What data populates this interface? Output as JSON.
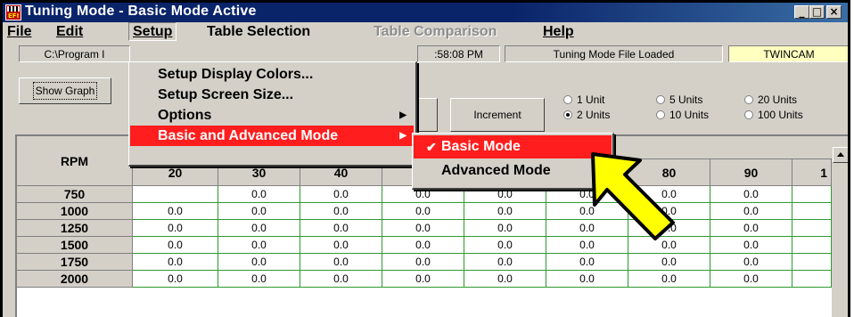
{
  "window": {
    "title": "Tuning Mode - Basic Mode Active",
    "controls": [
      "_",
      "□",
      "×"
    ]
  },
  "menubar": {
    "file": "File",
    "edit": "Edit",
    "setup": "Setup",
    "table_selection": "Table Selection",
    "table_comparison": "Table Comparison",
    "help": "Help"
  },
  "toolbar": {
    "path": "C:\\Program I",
    "time": ":58:08 PM",
    "status": "Tuning Mode File Loaded",
    "engine": "TWINCAM",
    "engine_color": "#ffffc0",
    "show_graph": "Show Graph",
    "increment": "Increment",
    "units": [
      {
        "label": "1 Unit",
        "selected": false
      },
      {
        "label": "2 Units",
        "selected": true
      },
      {
        "label": "5 Units",
        "selected": false
      },
      {
        "label": "10 Units",
        "selected": false
      },
      {
        "label": "20 Units",
        "selected": false
      },
      {
        "label": "100 Units",
        "selected": false
      }
    ]
  },
  "setup_menu": {
    "items": [
      {
        "label": "Setup Display Colors...",
        "submenu": false
      },
      {
        "label": "Setup Screen Size...",
        "submenu": false
      },
      {
        "label": "Options",
        "submenu": true
      },
      {
        "label": "Basic and Advanced Mode",
        "submenu": true,
        "highlighted": true
      }
    ],
    "highlight_color": "#ff1d1d"
  },
  "mode_submenu": {
    "items": [
      {
        "label": "Basic Mode",
        "checked": true,
        "highlighted": true
      },
      {
        "label": "Advanced Mode",
        "checked": false
      }
    ]
  },
  "table": {
    "row_header": "RPM",
    "columns": [
      "20",
      "30",
      "40",
      "",
      "",
      "",
      "80",
      "90",
      "1"
    ],
    "rows": [
      {
        "rpm": "750",
        "values": [
          "",
          "0.0",
          "0.0",
          "0.0",
          "0.0",
          "0.0",
          "0.0",
          "0.0",
          ""
        ]
      },
      {
        "rpm": "1000",
        "values": [
          "0.0",
          "0.0",
          "0.0",
          "0.0",
          "0.0",
          "0.0",
          "0.0",
          "0.0",
          ""
        ]
      },
      {
        "rpm": "1250",
        "values": [
          "0.0",
          "0.0",
          "0.0",
          "0.0",
          "0.0",
          "0.0",
          "0.0",
          "0.0",
          ""
        ]
      },
      {
        "rpm": "1500",
        "values": [
          "0.0",
          "0.0",
          "0.0",
          "0.0",
          "0.0",
          "0.0",
          "0.0",
          "0.0",
          ""
        ]
      },
      {
        "rpm": "1750",
        "values": [
          "0.0",
          "0.0",
          "0.0",
          "0.0",
          "0.0",
          "0.0",
          "0.0",
          "0.0",
          ""
        ]
      },
      {
        "rpm": "2000",
        "values": [
          "0.0",
          "0.0",
          "0.0",
          "0.0",
          "0.0",
          "0.0",
          "0.0",
          "0.0",
          ""
        ]
      }
    ],
    "grid_color": "#2e9a2e"
  },
  "annotation": {
    "pointer": "yellow-arrow",
    "pointer_color": "#ffff00"
  }
}
